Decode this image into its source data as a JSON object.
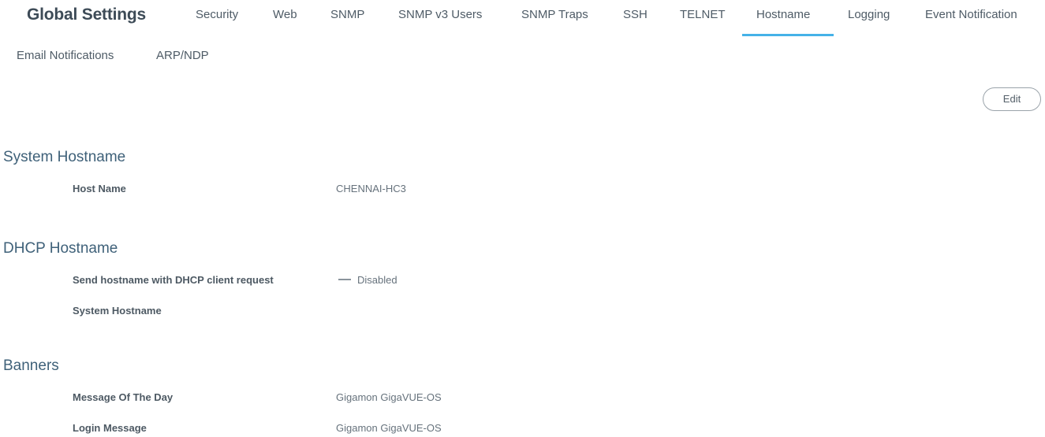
{
  "header": {
    "title": "Global Settings"
  },
  "tabs": [
    {
      "label": "Security",
      "active": false
    },
    {
      "label": "Web",
      "active": false
    },
    {
      "label": "SNMP",
      "active": false
    },
    {
      "label": "SNMP v3 Users",
      "active": false
    },
    {
      "label": "SNMP Traps",
      "active": false
    },
    {
      "label": "SSH",
      "active": false
    },
    {
      "label": "TELNET",
      "active": false
    },
    {
      "label": "Hostname",
      "active": true
    },
    {
      "label": "Logging",
      "active": false
    },
    {
      "label": "Event Notification",
      "active": false
    },
    {
      "label": "Email Notifications",
      "active": false
    },
    {
      "label": "ARP/NDP",
      "active": false
    }
  ],
  "toolbar": {
    "edit_label": "Edit"
  },
  "sections": {
    "system_hostname": {
      "title": "System Hostname",
      "fields": [
        {
          "label": "Host Name",
          "value": "CHENNAI-HC3"
        }
      ]
    },
    "dhcp_hostname": {
      "title": "DHCP Hostname",
      "fields": [
        {
          "label": "Send hostname with DHCP client request",
          "value": "Disabled",
          "icon": "dash-icon"
        },
        {
          "label": "System Hostname",
          "value": ""
        }
      ]
    },
    "banners": {
      "title": "Banners",
      "fields": [
        {
          "label": "Message Of The Day",
          "value": "Gigamon GigaVUE-OS"
        },
        {
          "label": "Login Message",
          "value": "Gigamon GigaVUE-OS"
        }
      ]
    }
  },
  "colors": {
    "accent": "#45b2e8",
    "section_title": "#3f6179"
  }
}
